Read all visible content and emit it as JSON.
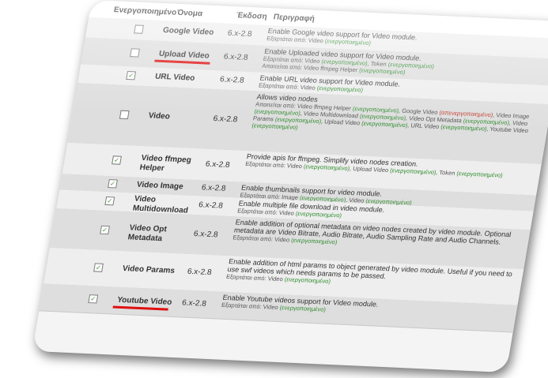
{
  "header": {
    "enabled": "Ενεργοποιημένο",
    "name": "Όνομα",
    "version": "Έκδοση",
    "description": "Περιγραφή"
  },
  "labels": {
    "depends_on": "Εξαρτάται από:",
    "required_by": "Απαιτείται από:",
    "enabled": "(ενεργοποιημένο)",
    "disabled": "(απενεργοποιημένο)"
  },
  "modules": [
    {
      "name": "Google Video",
      "version": "6.x-2.8",
      "checked": false,
      "description": "Enable Google video support for Video module.",
      "sub": "Εξαρτάται από: Video (ενεργοποιημένο)"
    },
    {
      "name": "Upload Video",
      "version": "6.x-2.8",
      "checked": false,
      "description": "Enable Uploaded video support for Video module.",
      "sub": "Εξαρτάται από: Video (ενεργοποιημένο), Token (ενεργοποιημένο)\nΑπαιτείται από: Video ffmpeg Helper (ενεργοποιημένο)",
      "highlight": "#e01010"
    },
    {
      "name": "URL Video",
      "version": "6.x-2.8",
      "checked": true,
      "description": "Enable URL video support for Video module.",
      "sub": "Εξαρτάται από: Video (ενεργοποιημένο)"
    },
    {
      "name": "Video",
      "version": "6.x-2.8",
      "checked": false,
      "description": "Allows video nodes",
      "sub": "Απαιτείται από: Video ffmpeg Helper (ενεργοποιημένο), Google Video (απενεργοποιημένο), Video Image (ενεργοποιημένο), Video Multidownload (ενεργοποιημένο), Video Opt Metadata (ενεργοποιημένο), Video Params (ενεργοποιημένο), Upload Video (ενεργοποιημένο), URL Video (ενεργοποιημένο), Youtube Video (ενεργοποιημένο)"
    },
    {
      "name": "Video ffmpeg Helper",
      "version": "6.x-2.8",
      "checked": true,
      "description": "Provide apis for ffmpeg. Simplify video nodes creation.",
      "sub": "Εξαρτάται από: Video (ενεργοποιημένο), Upload Video (ενεργοποιημένο), Token (ενεργοποιημένο)"
    },
    {
      "name": "Video Image",
      "version": "6.x-2.8",
      "checked": true,
      "description": "Enable thumbnails support for video module.",
      "sub": "Εξαρτάται από: Image (ενεργοποιημένο), Video (ενεργοποιημένο)"
    },
    {
      "name": "Video Multidownload",
      "version": "6.x-2.8",
      "checked": true,
      "description": "Enable multiple file download in video module.",
      "sub": "Εξαρτάται από: Video (ενεργοποιημένο)"
    },
    {
      "name": "Video Opt Metadata",
      "version": "6.x-2.8",
      "checked": true,
      "description": "Enable addition of optional metadata on video nodes created by video module. Optional metadata are Video Bitrate, Audio Bitrate, Audio Sampling Rate and Audio Channels.",
      "sub": "Εξαρτάται από: Video (ενεργοποιημένο)"
    },
    {
      "name": "Video Params",
      "version": "6.x-2.8",
      "checked": true,
      "description": "Enable addition of html params to object generated by video module. Useful if you need to use swf videos which needs params to be passed.",
      "sub": "Εξαρτάται από: Video (ενεργοποιημένο)"
    },
    {
      "name": "Youtube Video",
      "version": "6.x-2.8",
      "checked": true,
      "description": "Enable Youtube videos support for Video module.",
      "sub": "Εξαρτάται από: Video (ενεργοποιημένο)",
      "highlight": "#e01010"
    }
  ]
}
